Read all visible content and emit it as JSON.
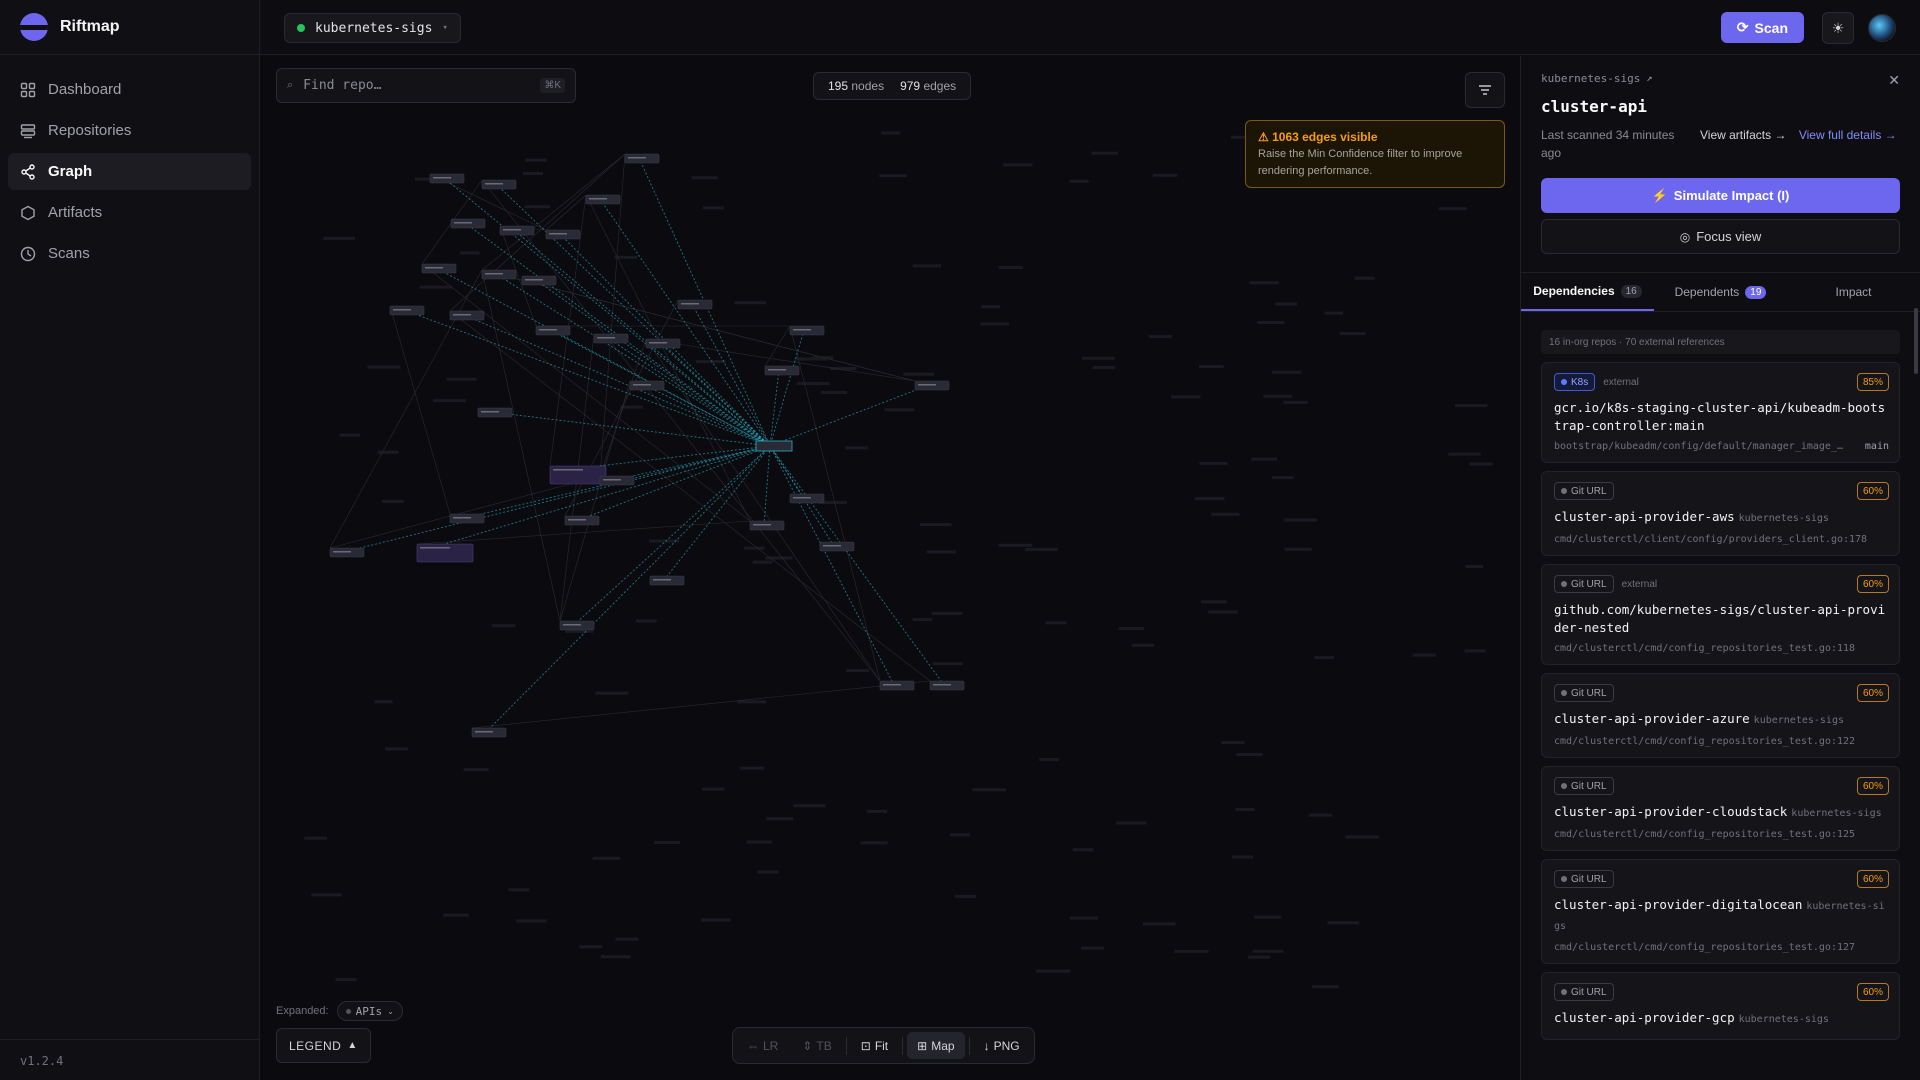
{
  "app": {
    "name": "Riftmap",
    "version": "v1.2.4"
  },
  "sidebar": {
    "items": [
      {
        "label": "Dashboard",
        "icon": "grid-icon"
      },
      {
        "label": "Repositories",
        "icon": "database-icon"
      },
      {
        "label": "Graph",
        "icon": "share-icon",
        "active": true
      },
      {
        "label": "Artifacts",
        "icon": "hexagon-icon"
      },
      {
        "label": "Scans",
        "icon": "clock-icon"
      }
    ]
  },
  "topbar": {
    "org": "kubernetes-sigs",
    "scan_label": "Scan"
  },
  "graph": {
    "search_placeholder": "Find repo…",
    "search_shortcut": "⌘K",
    "nodes_count": "195",
    "nodes_label": "nodes",
    "edges_count": "979",
    "edges_label": "edges",
    "warning_title": "⚠ 1063 edges visible",
    "warning_text": "Raise the Min Confidence filter to improve rendering performance.",
    "expanded_label": "Expanded:",
    "expanded_chip": "APIs",
    "legend_label": "LEGEND",
    "toolbar": {
      "lr": "LR",
      "tb": "TB",
      "fit": "Fit",
      "map": "Map",
      "png": "PNG"
    },
    "colors": {
      "edge": "#22b3c9",
      "node": "#2a2a36",
      "accent": "#6d67f0"
    }
  },
  "panel": {
    "org": "kubernetes-sigs",
    "title": "cluster-api",
    "scanned": "Last scanned 34 minutes ago",
    "view_artifacts": "View artifacts →",
    "view_details": "View full details →",
    "simulate_label": "Simulate Impact (I)",
    "focus_label": "Focus view",
    "tabs": [
      {
        "label": "Dependencies",
        "count": "16"
      },
      {
        "label": "Dependents",
        "count": "19"
      },
      {
        "label": "Impact",
        "count": ""
      }
    ],
    "summary": "16 in-org repos · 70 external references",
    "deps": [
      {
        "tag": "K8s",
        "kind": "k8s",
        "scope": "external",
        "confidence": "85%",
        "name": "gcr.io/k8s-staging-cluster-api/kubeadm-bootstrap-controller:main",
        "owner": "",
        "path": "bootstrap/kubeadm/config/default/manager_image_…",
        "branch": "main"
      },
      {
        "tag": "Git URL",
        "kind": "git",
        "scope": "",
        "confidence": "60%",
        "name": "cluster-api-provider-aws",
        "owner": "kubernetes-sigs",
        "path": "cmd/clusterctl/client/config/providers_client.go:178",
        "branch": ""
      },
      {
        "tag": "Git URL",
        "kind": "git",
        "scope": "external",
        "confidence": "60%",
        "name": "github.com/kubernetes-sigs/cluster-api-provider-nested",
        "owner": "",
        "path": "cmd/clusterctl/cmd/config_repositories_test.go:118",
        "branch": ""
      },
      {
        "tag": "Git URL",
        "kind": "git",
        "scope": "",
        "confidence": "60%",
        "name": "cluster-api-provider-azure",
        "owner": "kubernetes-sigs",
        "path": "cmd/clusterctl/cmd/config_repositories_test.go:122",
        "branch": ""
      },
      {
        "tag": "Git URL",
        "kind": "git",
        "scope": "",
        "confidence": "60%",
        "name": "cluster-api-provider-cloudstack",
        "owner": "kubernetes-sigs",
        "path": "cmd/clusterctl/cmd/config_repositories_test.go:125",
        "branch": ""
      },
      {
        "tag": "Git URL",
        "kind": "git",
        "scope": "",
        "confidence": "60%",
        "name": "cluster-api-provider-digitalocean",
        "owner": "kubernetes-sigs",
        "path": "cmd/clusterctl/cmd/config_repositories_test.go:127",
        "branch": ""
      },
      {
        "tag": "Git URL",
        "kind": "git",
        "scope": "",
        "confidence": "60%",
        "name": "cluster-api-provider-gcp",
        "owner": "kubernetes-sigs",
        "path": "",
        "branch": ""
      }
    ]
  }
}
